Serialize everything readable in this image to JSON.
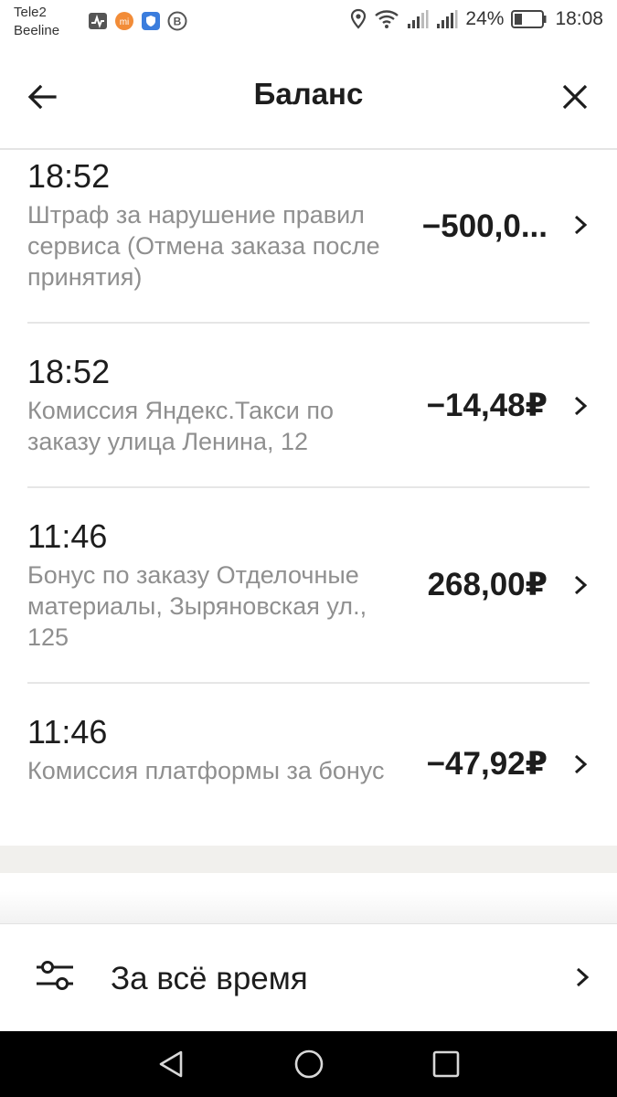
{
  "status_bar": {
    "carrier1": "Tele2",
    "carrier2": "Beeline",
    "battery": "24%",
    "time": "18:08"
  },
  "header": {
    "title": "Баланс"
  },
  "transactions": [
    {
      "time": "18:52",
      "description": "Штраф за нарушение правил сервиса (Отмена заказа после принятия)",
      "amount": "−500,0..."
    },
    {
      "time": "18:52",
      "description": "Комиссия Яндекс.Такси по заказу улица Ленина, 12",
      "amount": "−14,48₽"
    },
    {
      "time": "11:46",
      "description": "Бонус по заказу Отделочные материалы, Зыряновская ул., 125",
      "amount": "268,00₽"
    },
    {
      "time": "11:46",
      "description": "Комиссия платформы за бонус",
      "amount": "−47,92₽"
    }
  ],
  "filter": {
    "label": "За всё время"
  },
  "colors": {
    "text_primary": "#1d1d1d",
    "text_secondary": "#8f8f8f",
    "divider": "#e6e6e6",
    "band": "#f1f0ed"
  }
}
